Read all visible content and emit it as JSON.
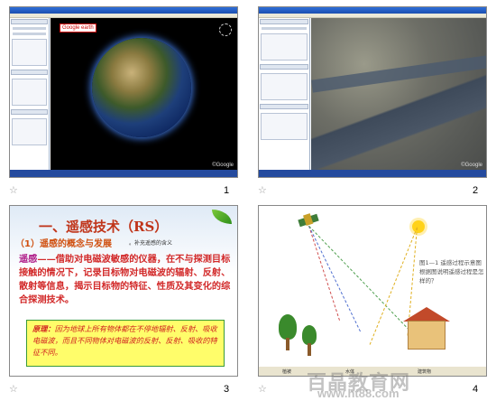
{
  "slides": [
    {
      "number": "1",
      "app_badge": "Google earth",
      "google_mark": "©Google"
    },
    {
      "number": "2",
      "google_mark": "©Google"
    },
    {
      "number": "3",
      "title": "一、遥感技术（RS）",
      "subtitle": "（1）遥感的概念与发展",
      "subtitle_note": "。补充遥感的含义",
      "body_keyword": "遥感",
      "body_text": "——借助对电磁波敏感的仪器，在不与探测目标接触的情况下，记录目标物对电磁波的辐射、反射、散射等信息，揭示目标物的特征、性质及其变化的综合探测技术。",
      "principle_label": "原理：",
      "principle_text": "因为地球上所有物体都在不停地辐射、反射、吸收电磁波，而且不同物体对电磁波的反射、反射、吸收的特征不同。"
    },
    {
      "number": "4",
      "side_text": "图1—1 遥感过程示意图 根据图说明遥感过程是怎样的？",
      "ground_labels": [
        "植被",
        "水体",
        "建筑物"
      ]
    }
  ],
  "watermark": {
    "text": "百晶教育网",
    "url": "www.ht88.com"
  },
  "star_glyph": "☆"
}
